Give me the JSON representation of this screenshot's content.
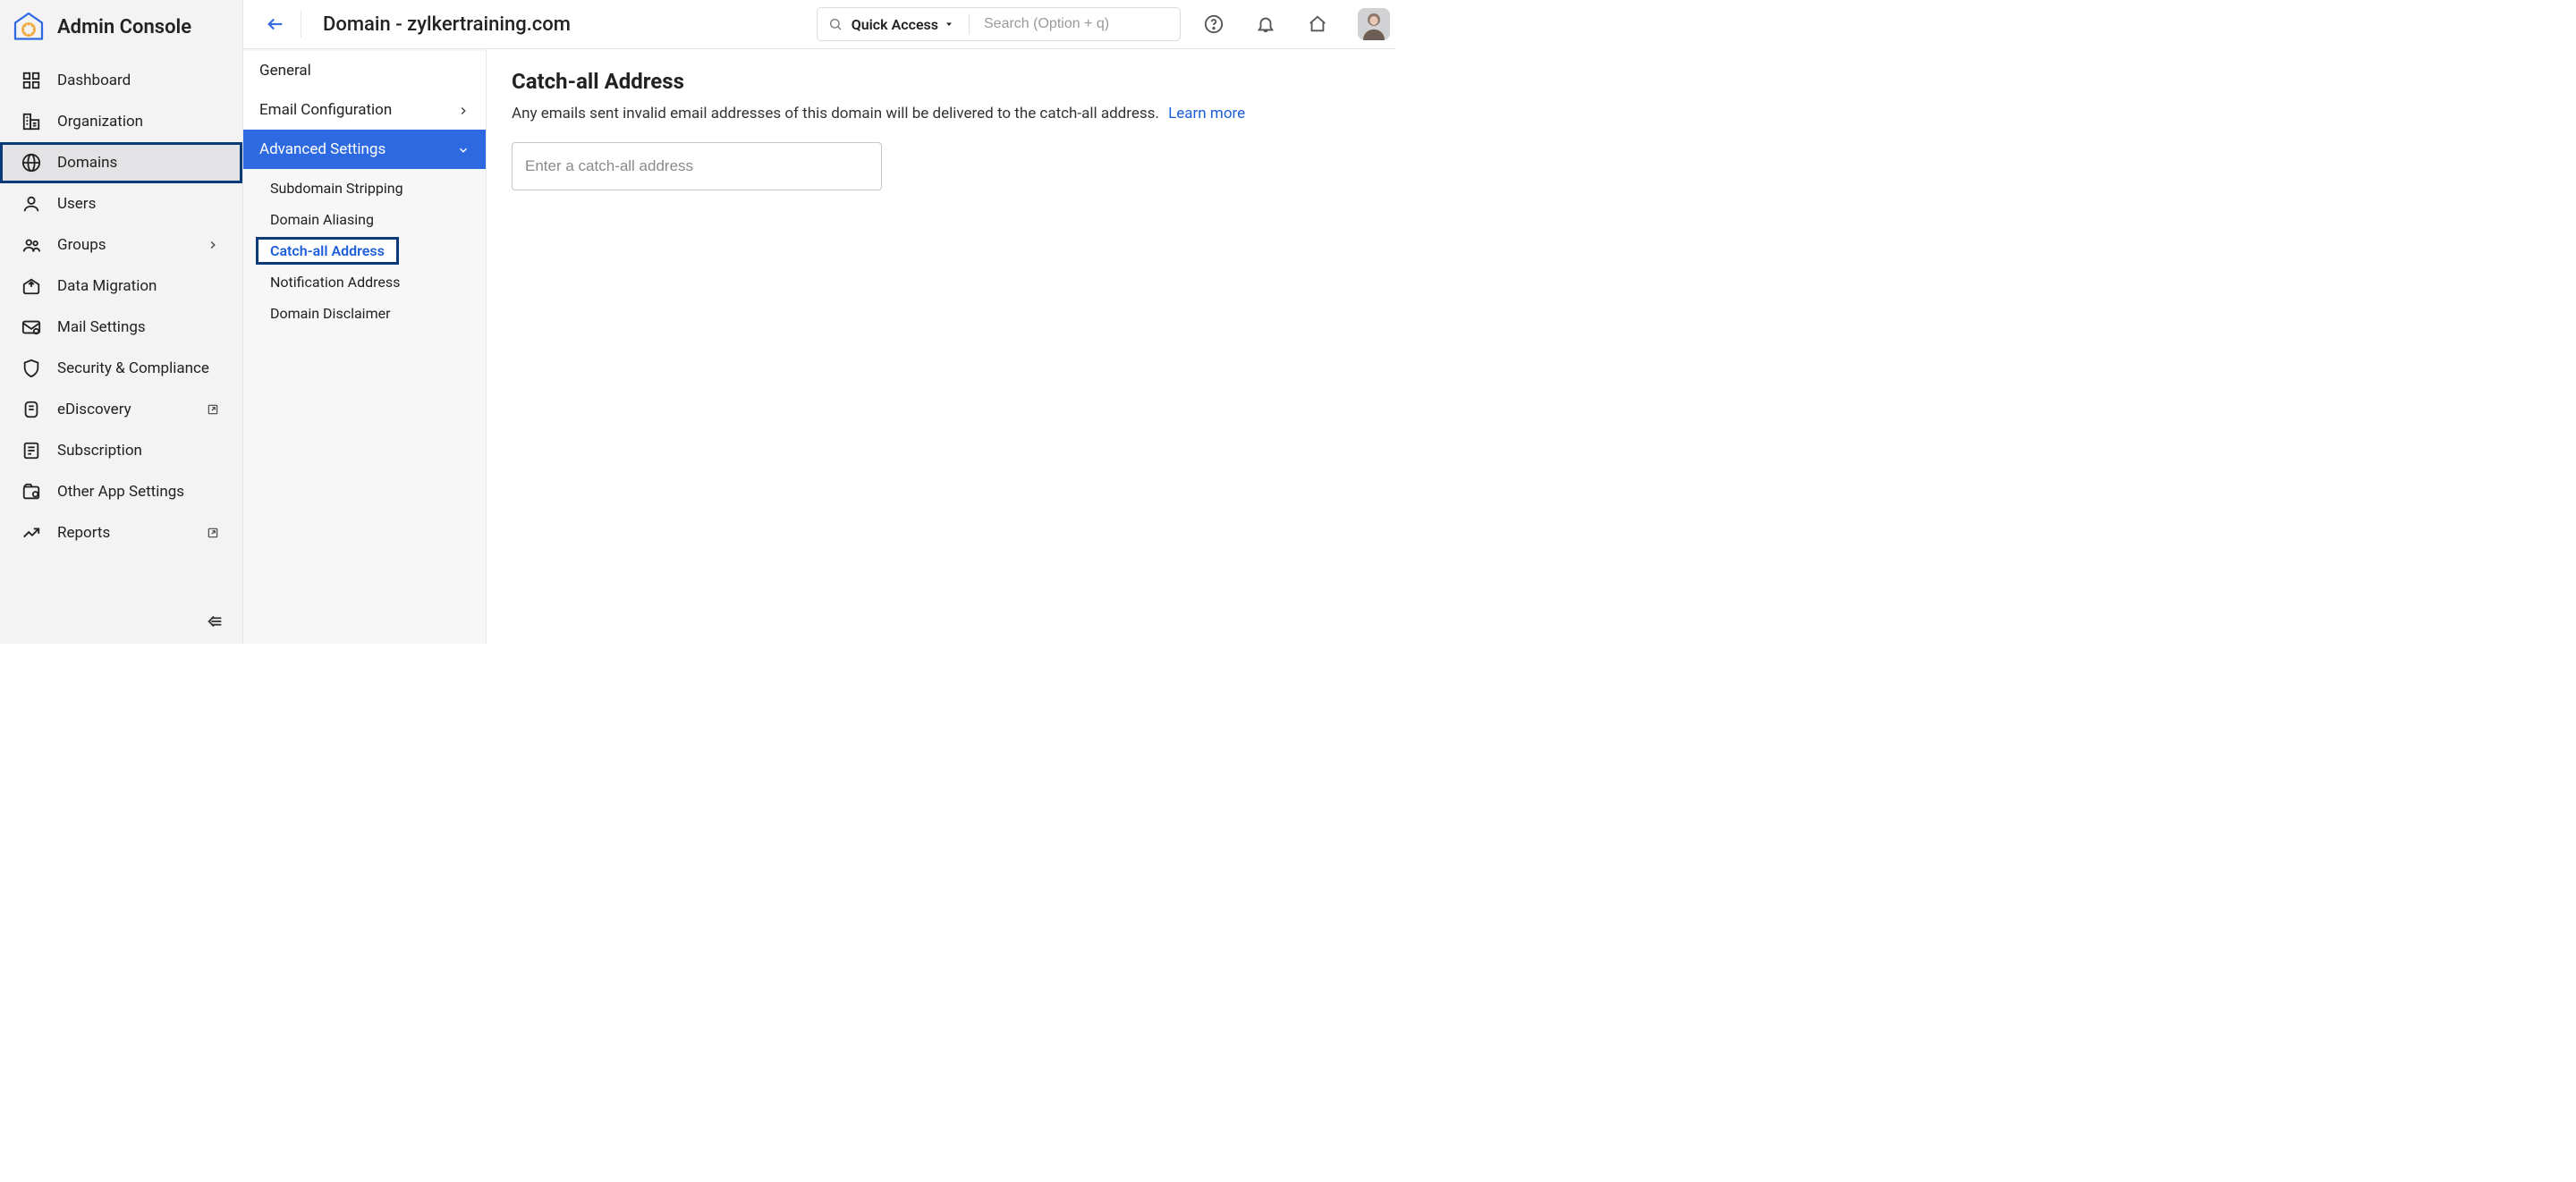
{
  "brand": {
    "title": "Admin Console"
  },
  "sidebar": {
    "items": [
      {
        "label": "Dashboard"
      },
      {
        "label": "Organization"
      },
      {
        "label": "Domains"
      },
      {
        "label": "Users"
      },
      {
        "label": "Groups"
      },
      {
        "label": "Data Migration"
      },
      {
        "label": "Mail Settings"
      },
      {
        "label": "Security & Compliance"
      },
      {
        "label": "eDiscovery"
      },
      {
        "label": "Subscription"
      },
      {
        "label": "Other App Settings"
      },
      {
        "label": "Reports"
      }
    ]
  },
  "header": {
    "page_title": "Domain - zylkertraining.com",
    "quick_access_label": "Quick Access",
    "search_placeholder": "Search (Option + q)"
  },
  "submenu": {
    "items": [
      {
        "label": "General"
      },
      {
        "label": "Email Configuration"
      },
      {
        "label": "Advanced Settings"
      }
    ],
    "advanced_children": [
      {
        "label": "Subdomain Stripping"
      },
      {
        "label": "Domain Aliasing"
      },
      {
        "label": "Catch-all Address"
      },
      {
        "label": "Notification Address"
      },
      {
        "label": "Domain Disclaimer"
      }
    ]
  },
  "content": {
    "title": "Catch-all Address",
    "description": "Any emails sent invalid email addresses of this domain will be delivered to the catch-all address.",
    "learn_more": "Learn more",
    "input_placeholder": "Enter a catch-all address"
  }
}
